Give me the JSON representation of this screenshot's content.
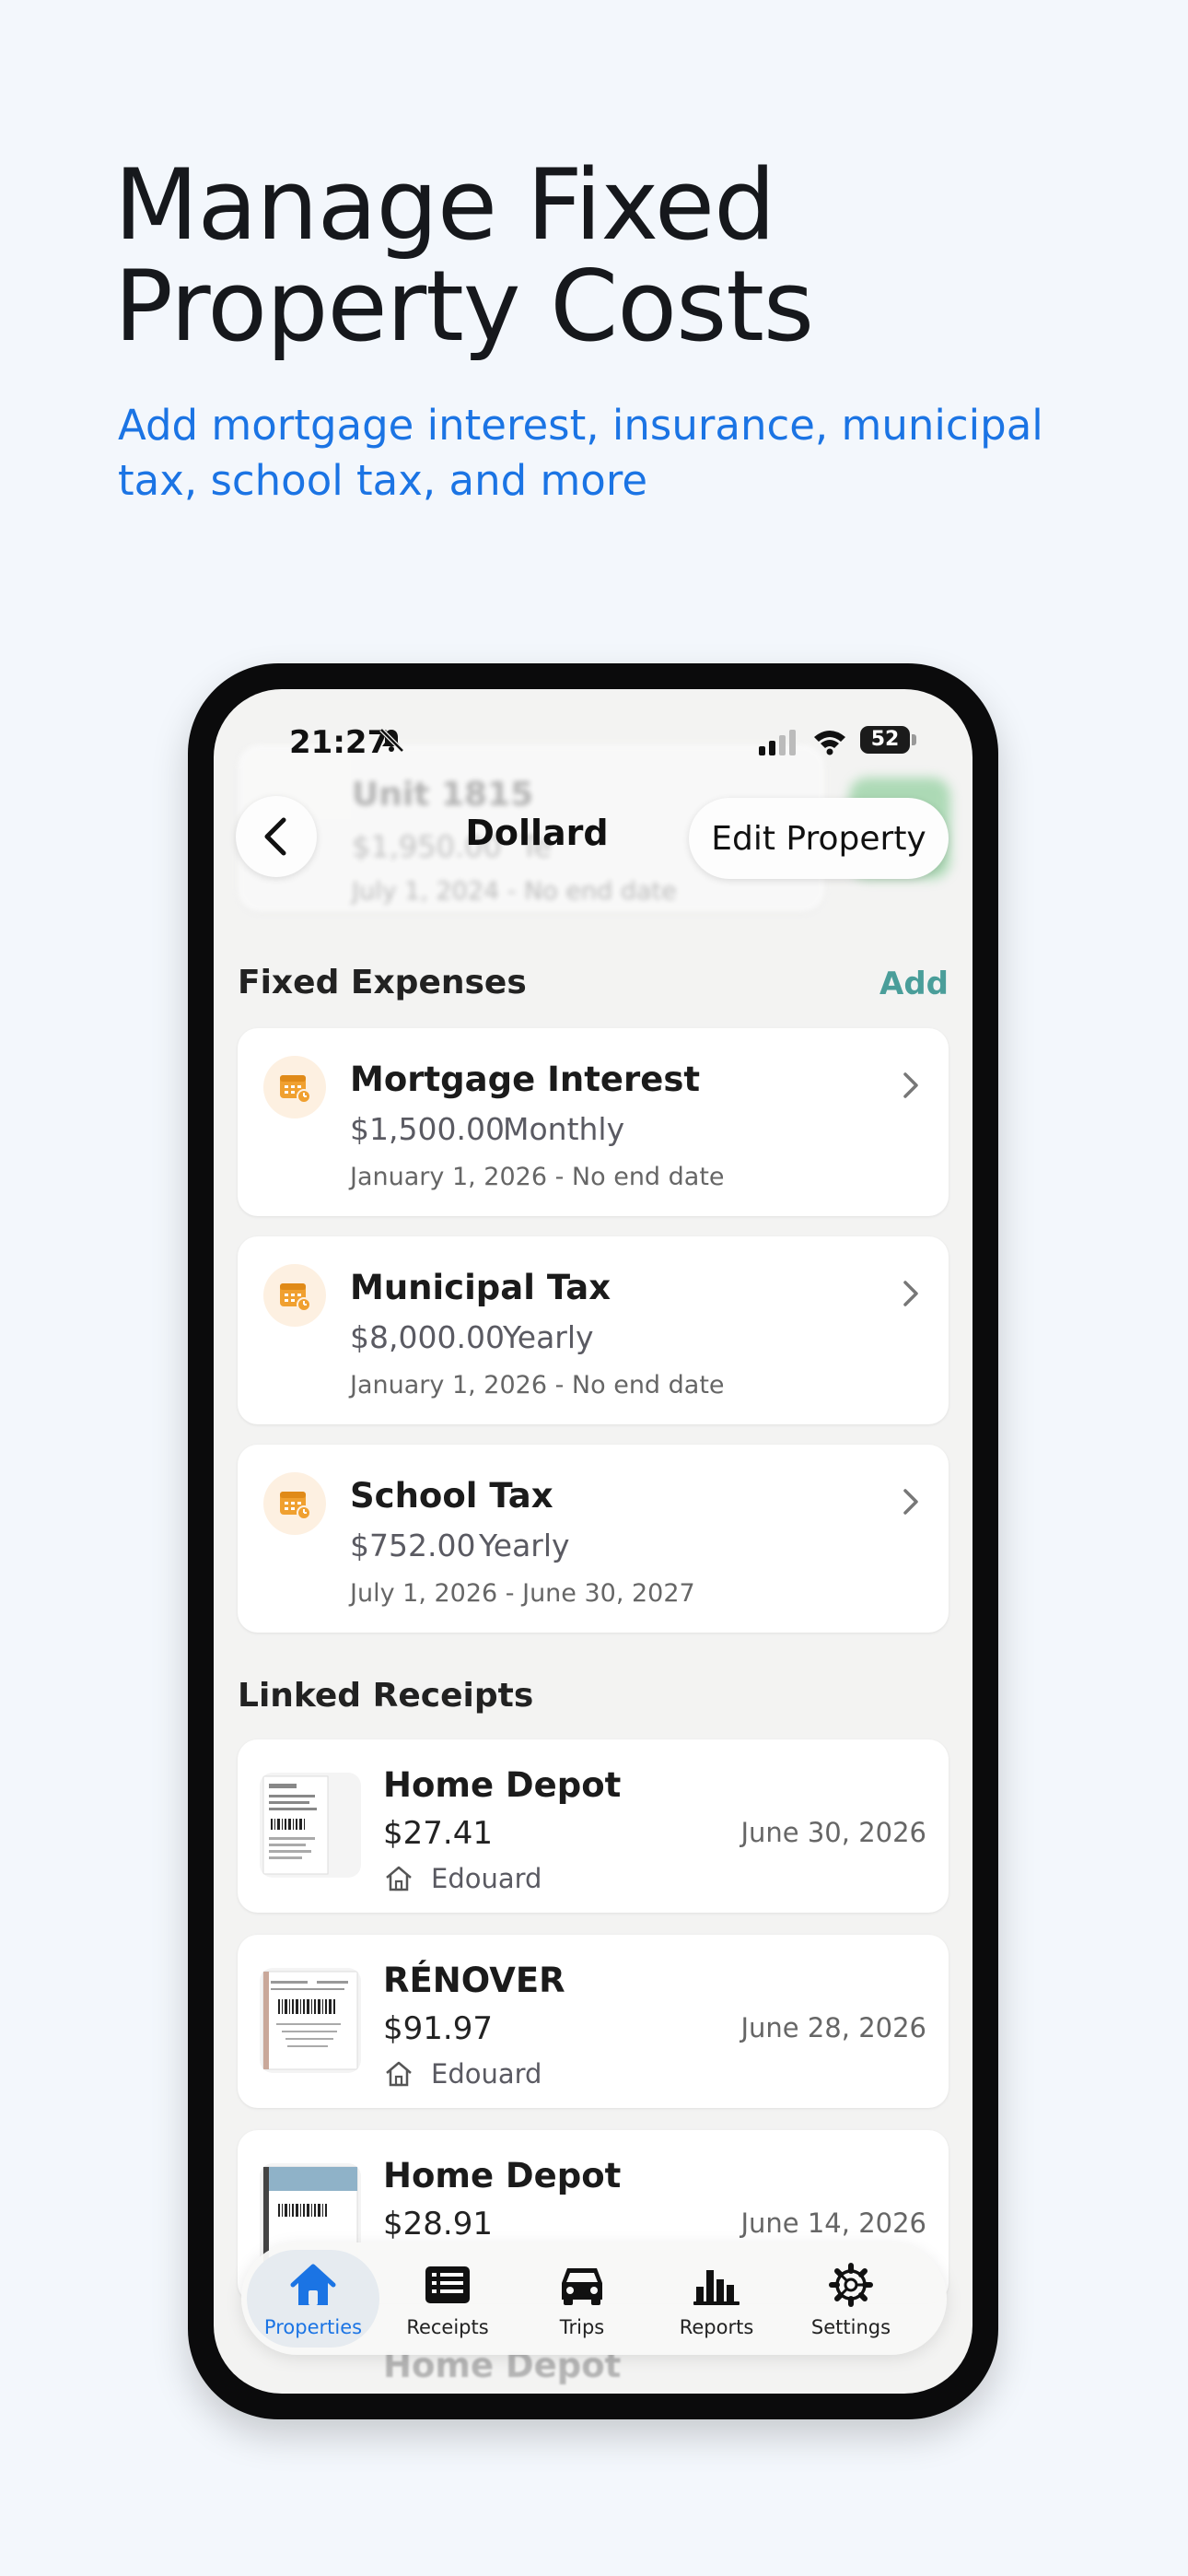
{
  "hero": {
    "title": "Manage Fixed Property Costs",
    "subtitle": "Add mortgage interest, insurance, municipal tax, school tax, and more"
  },
  "status_bar": {
    "time": "21:27",
    "battery": "52"
  },
  "background_card": {
    "unit": "Unit 1815",
    "rent": "$1,950.00",
    "rent_suffix": "Te",
    "dates": "July 1, 2024 - No end date"
  },
  "header": {
    "title": "Dollard",
    "edit_label": "Edit Property"
  },
  "fixed_expenses": {
    "title": "Fixed Expenses",
    "add_label": "Add",
    "items": [
      {
        "name": "Mortgage Interest",
        "amount": "$1,500.00",
        "frequency": "Monthly",
        "dates": "January 1, 2026 - No end date"
      },
      {
        "name": "Municipal Tax",
        "amount": "$8,000.00",
        "frequency": "Yearly",
        "dates": "January 1, 2026 - No end date"
      },
      {
        "name": "School Tax",
        "amount": "$752.00",
        "frequency": "Yearly",
        "dates": "July 1, 2026 - June 30, 2027"
      }
    ]
  },
  "linked_receipts": {
    "title": "Linked Receipts",
    "items": [
      {
        "store": "Home Depot",
        "amount": "$27.41",
        "property": "Edouard",
        "date": "June 30, 2026"
      },
      {
        "store": "RÉNOVER",
        "amount": "$91.97",
        "property": "Edouard",
        "date": "June 28, 2026"
      },
      {
        "store": "Home Depot",
        "amount": "$28.91",
        "property": "",
        "date": "June 14, 2026"
      }
    ],
    "next_hidden_store": "Home Depot"
  },
  "tabbar": {
    "tabs": [
      {
        "label": "Properties",
        "icon": "house-icon",
        "active": true
      },
      {
        "label": "Receipts",
        "icon": "receipt-icon",
        "active": false
      },
      {
        "label": "Trips",
        "icon": "car-icon",
        "active": false
      },
      {
        "label": "Reports",
        "icon": "bar-chart-icon",
        "active": false
      },
      {
        "label": "Settings",
        "icon": "gear-icon",
        "active": false
      }
    ]
  },
  "colors": {
    "accent": "#1b74e4",
    "add_teal": "#4a9e9a",
    "expense_icon": "#f0a030"
  }
}
